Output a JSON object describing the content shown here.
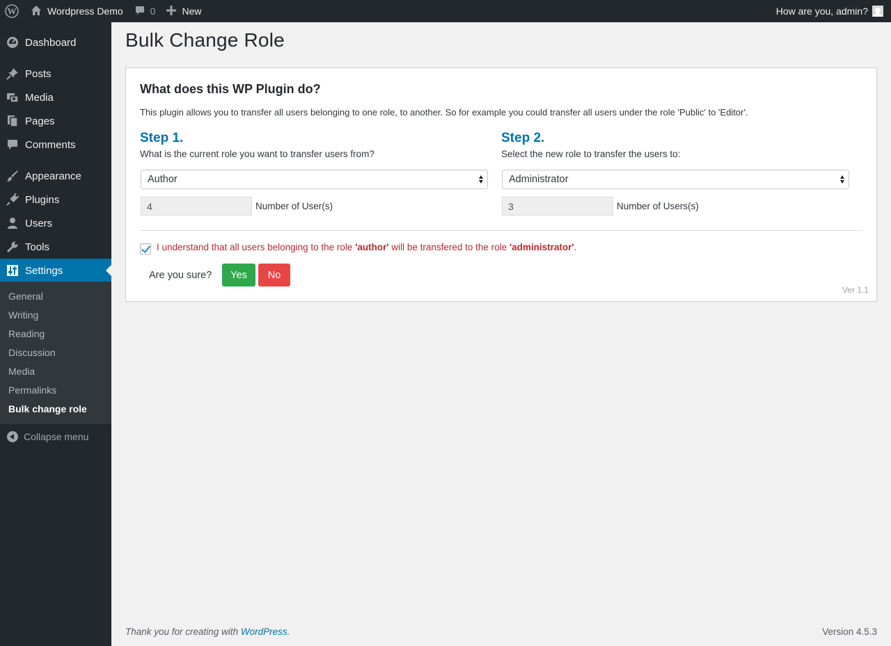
{
  "adminbar": {
    "site_name": "Wordpress Demo",
    "comments_count": "0",
    "new_label": "New",
    "greeting": "How are you, admin?"
  },
  "sidebar": {
    "items": [
      {
        "label": "Dashboard",
        "icon": "dashboard-icon"
      },
      {
        "label": "Posts",
        "icon": "pin-icon"
      },
      {
        "label": "Media",
        "icon": "media-icon"
      },
      {
        "label": "Pages",
        "icon": "pages-icon"
      },
      {
        "label": "Comments",
        "icon": "comment-icon"
      },
      {
        "label": "Appearance",
        "icon": "brush-icon"
      },
      {
        "label": "Plugins",
        "icon": "plugin-icon"
      },
      {
        "label": "Users",
        "icon": "user-icon"
      },
      {
        "label": "Tools",
        "icon": "wrench-icon"
      },
      {
        "label": "Settings",
        "icon": "settings-icon"
      }
    ],
    "submenu": [
      "General",
      "Writing",
      "Reading",
      "Discussion",
      "Media",
      "Permalinks",
      "Bulk change role"
    ],
    "collapse_label": "Collapse menu"
  },
  "page": {
    "title": "Bulk Change Role"
  },
  "panel": {
    "heading": "What does this WP Plugin do?",
    "description": "This plugin allows you to transfer all users belonging to one role, to another. So for example you could transfer all users under the role 'Public' to 'Editor'.",
    "step1": {
      "title": "Step 1.",
      "question": "What is the current role you want to transfer users from?",
      "selected": "Author",
      "count": "4",
      "count_label": "Number of User(s)"
    },
    "step2": {
      "title": "Step 2.",
      "question": "Select the new role to transfer the users to:",
      "selected": "Administrator",
      "count": "3",
      "count_label": "Number of Users(s)"
    },
    "confirm": {
      "prefix": "I understand that all users belonging to the role ",
      "from_role": "'author'",
      "middle": " will be transfered to the role ",
      "to_role": "'administrator'",
      "suffix": "."
    },
    "are_you_sure": "Are you sure?",
    "yes_label": "Yes",
    "no_label": "No",
    "version": "Ver 1.1"
  },
  "footer": {
    "thanks_prefix": "Thank you for creating with ",
    "thanks_link": "WordPress",
    "thanks_suffix": ".",
    "version": "Version 4.5.3"
  },
  "colors": {
    "accent": "#0073aa",
    "adminbar": "#23282d",
    "yes": "#2ea84a",
    "no": "#e84646",
    "warning_text": "#b32d2e"
  }
}
